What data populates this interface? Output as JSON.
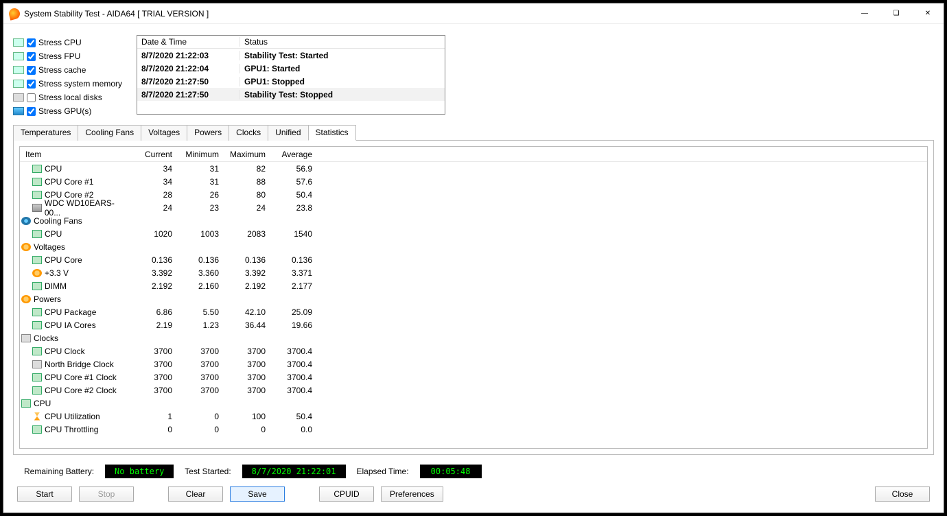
{
  "window": {
    "title": "System Stability Test - AIDA64  [ TRIAL VERSION ]"
  },
  "stress": [
    {
      "label": "Stress CPU",
      "checked": true,
      "iconClass": ""
    },
    {
      "label": "Stress FPU",
      "checked": true,
      "iconClass": ""
    },
    {
      "label": "Stress cache",
      "checked": true,
      "iconClass": ""
    },
    {
      "label": "Stress system memory",
      "checked": true,
      "iconClass": ""
    },
    {
      "label": "Stress local disks",
      "checked": false,
      "iconClass": "disk"
    },
    {
      "label": "Stress GPU(s)",
      "checked": true,
      "iconClass": "gpu"
    }
  ],
  "log": {
    "headers": {
      "datetime": "Date & Time",
      "status": "Status"
    },
    "rows": [
      {
        "dt": "8/7/2020 21:22:03",
        "st": "Stability Test: Started"
      },
      {
        "dt": "8/7/2020 21:22:04",
        "st": "GPU1: Started"
      },
      {
        "dt": "8/7/2020 21:27:50",
        "st": "GPU1: Stopped"
      },
      {
        "dt": "8/7/2020 21:27:50",
        "st": "Stability Test: Stopped",
        "selected": true
      }
    ]
  },
  "tabs": [
    "Temperatures",
    "Cooling Fans",
    "Voltages",
    "Powers",
    "Clocks",
    "Unified",
    "Statistics"
  ],
  "activeTab": "Statistics",
  "stats": {
    "headers": {
      "item": "Item",
      "current": "Current",
      "min": "Minimum",
      "max": "Maximum",
      "avg": "Average"
    },
    "rows": [
      {
        "indent": 1,
        "icon": "chip",
        "item": "CPU",
        "cur": "34",
        "min": "31",
        "max": "82",
        "avg": "56.9"
      },
      {
        "indent": 1,
        "icon": "chip",
        "item": "CPU Core #1",
        "cur": "34",
        "min": "31",
        "max": "88",
        "avg": "57.6"
      },
      {
        "indent": 1,
        "icon": "chip",
        "item": "CPU Core #2",
        "cur": "28",
        "min": "26",
        "max": "80",
        "avg": "50.4"
      },
      {
        "indent": 1,
        "icon": "hdd",
        "item": "WDC WD10EARS-00...",
        "cur": "24",
        "min": "23",
        "max": "24",
        "avg": "23.8"
      },
      {
        "indent": 0,
        "icon": "fan",
        "item": "Cooling Fans"
      },
      {
        "indent": 1,
        "icon": "chip",
        "item": "CPU",
        "cur": "1020",
        "min": "1003",
        "max": "2083",
        "avg": "1540"
      },
      {
        "indent": 0,
        "icon": "volt",
        "item": "Voltages"
      },
      {
        "indent": 1,
        "icon": "chip",
        "item": "CPU Core",
        "cur": "0.136",
        "min": "0.136",
        "max": "0.136",
        "avg": "0.136"
      },
      {
        "indent": 1,
        "icon": "volt",
        "item": "+3.3 V",
        "cur": "3.392",
        "min": "3.360",
        "max": "3.392",
        "avg": "3.371"
      },
      {
        "indent": 1,
        "icon": "chip",
        "item": "DIMM",
        "cur": "2.192",
        "min": "2.160",
        "max": "2.192",
        "avg": "2.177"
      },
      {
        "indent": 0,
        "icon": "volt",
        "item": "Powers"
      },
      {
        "indent": 1,
        "icon": "chip",
        "item": "CPU Package",
        "cur": "6.86",
        "min": "5.50",
        "max": "42.10",
        "avg": "25.09"
      },
      {
        "indent": 1,
        "icon": "chip",
        "item": "CPU IA Cores",
        "cur": "2.19",
        "min": "1.23",
        "max": "36.44",
        "avg": "19.66"
      },
      {
        "indent": 0,
        "icon": "clk",
        "item": "Clocks"
      },
      {
        "indent": 1,
        "icon": "chip",
        "item": "CPU Clock",
        "cur": "3700",
        "min": "3700",
        "max": "3700",
        "avg": "3700.4"
      },
      {
        "indent": 1,
        "icon": "clk",
        "item": "North Bridge Clock",
        "cur": "3700",
        "min": "3700",
        "max": "3700",
        "avg": "3700.4"
      },
      {
        "indent": 1,
        "icon": "chip",
        "item": "CPU Core #1 Clock",
        "cur": "3700",
        "min": "3700",
        "max": "3700",
        "avg": "3700.4"
      },
      {
        "indent": 1,
        "icon": "chip",
        "item": "CPU Core #2 Clock",
        "cur": "3700",
        "min": "3700",
        "max": "3700",
        "avg": "3700.4"
      },
      {
        "indent": 0,
        "icon": "chip",
        "item": "CPU"
      },
      {
        "indent": 1,
        "icon": "hour",
        "item": "CPU Utilization",
        "cur": "1",
        "min": "0",
        "max": "100",
        "avg": "50.4"
      },
      {
        "indent": 1,
        "icon": "chip",
        "item": "CPU Throttling",
        "cur": "0",
        "min": "0",
        "max": "0",
        "avg": "0.0"
      }
    ]
  },
  "status": {
    "battery_label": "Remaining Battery:",
    "battery_value": "No battery",
    "started_label": "Test Started:",
    "started_value": "8/7/2020 21:22:01",
    "elapsed_label": "Elapsed Time:",
    "elapsed_value": "00:05:48"
  },
  "buttons": {
    "start": "Start",
    "stop": "Stop",
    "clear": "Clear",
    "save": "Save",
    "cpuid": "CPUID",
    "prefs": "Preferences",
    "close": "Close"
  }
}
